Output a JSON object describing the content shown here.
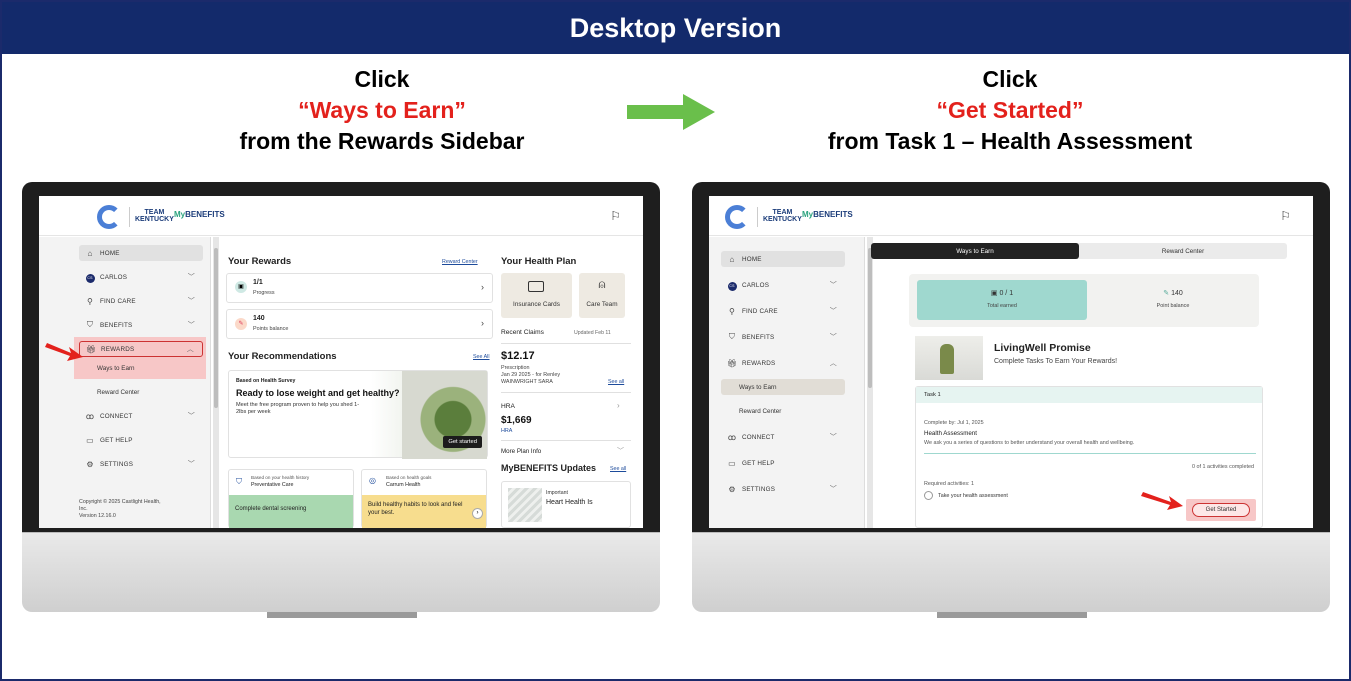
{
  "banner": {
    "title": "Desktop Version"
  },
  "instructions": {
    "left": {
      "line1": "Click",
      "highlight": "“Ways to Earn”",
      "line3": "from the Rewards Sidebar"
    },
    "right": {
      "line1": "Click",
      "highlight": "“Get Started”",
      "line3": "from Task 1 – Health Assessment"
    }
  },
  "colors": {
    "banner": "#132a6b",
    "highlight": "#e3211c",
    "arrow": "#6abf4b",
    "callout_bg": "#f7c7c7",
    "teal_card": "#9fd8cf",
    "green_tile": "#a9d8b0",
    "yellow_tile": "#f7dd8e"
  },
  "app": {
    "logo_team": "TEAM",
    "logo_kentucky": "KENTUCKY",
    "logo_brand_my": "My",
    "logo_brand": "BENEFITS",
    "header_icon": "flag-icon"
  },
  "sidebar": {
    "items": [
      {
        "label": "HOME",
        "icon": "home-icon"
      },
      {
        "label": "CARLOS",
        "icon": "avatar-icon"
      },
      {
        "label": "FIND CARE",
        "icon": "search-icon"
      },
      {
        "label": "BENEFITS",
        "icon": "shield-icon"
      },
      {
        "label": "REWARDS",
        "icon": "gift-icon"
      },
      {
        "label": "CONNECT",
        "icon": "people-icon"
      },
      {
        "label": "GET HELP",
        "icon": "chat-icon"
      },
      {
        "label": "SETTINGS",
        "icon": "gear-icon"
      }
    ],
    "avatar_initials": "CS",
    "rewards_sub": [
      "Ways to Earn",
      "Reward Center"
    ],
    "copyright": [
      "Copyright © 2025 Castlight Health,",
      "Inc.",
      "Version 12.16.0"
    ]
  },
  "left_screen": {
    "your_rewards": "Your Rewards",
    "reward_center_link": "Reward Center",
    "progress_value": "1/1",
    "progress_label": "Progress",
    "points_value": "140",
    "points_label": "Points balance",
    "recommendations": "Your Recommendations",
    "see_all": "See All",
    "rec_tag": "Based on Health Survey",
    "rec_title": "Ready to lose weight and get healthy?",
    "rec_desc": "Meet the free program proven to help you shed 1-2lbs per week",
    "rec_cta": "Get started",
    "tile1_tag": "Based on your health history",
    "tile1_title": "Preventative Care",
    "tile1_body": "Complete dental screening",
    "tile2_tag": "Based on health goals",
    "tile2_title": "Carrum Health",
    "tile2_body": "Build healthy habits to look and feel your best.",
    "health_plan": "Your Health Plan",
    "insurance_cards": "Insurance Cards",
    "care_team": "Care Team",
    "recent_claims": "Recent Claims",
    "updated": "Updated Feb 11",
    "claim_amount": "$12.17",
    "claim_type": "Prescription",
    "claim_date": "Jan 29 2025 - for Renley",
    "claim_provider": "WAINWRIGHT SARA",
    "claim_see_all": "See all",
    "hra_label": "HRA",
    "hra_amount": "$1,669",
    "hra_sub": "HRA",
    "more_plan": "More Plan Info",
    "updates": "MyBENEFITS Updates",
    "updates_see_all": "See all",
    "important": "Important",
    "heart_health": "Heart Health Is"
  },
  "right_screen": {
    "tab_ways": "Ways to Earn",
    "tab_center": "Reward Center",
    "total_earned_value": "0 / 1",
    "total_earned_label": "Total earned",
    "point_balance_value": "140",
    "point_balance_label": "Point balance",
    "program_title": "LivingWell Promise",
    "program_sub": "Complete Tasks To Earn Your Rewards!",
    "task_label": "Task 1",
    "complete_by": "Complete by: Jul 1, 2025",
    "task_title": "Health Assessment",
    "task_desc": "We ask you a series of questions to better understand your overall health and wellbeing.",
    "activities_completed": "0 of 1 activities completed",
    "required": "Required activities: 1",
    "activity": "Take your health assessment",
    "get_started": "Get Started"
  }
}
